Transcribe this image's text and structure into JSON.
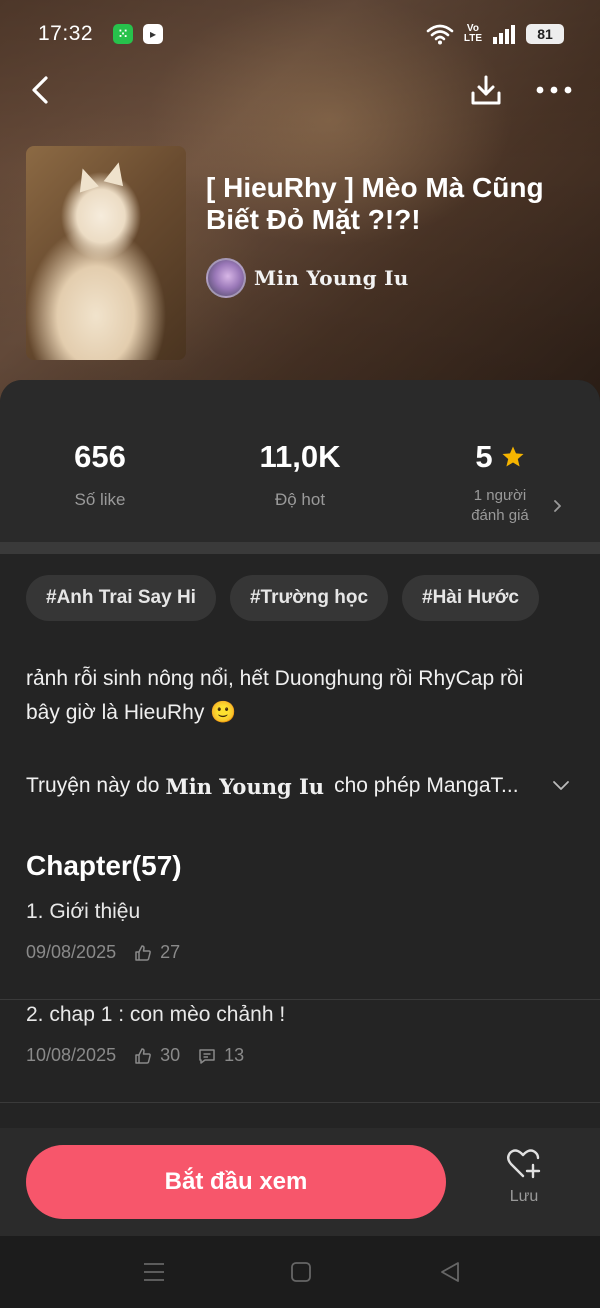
{
  "status_bar": {
    "time": "17:32",
    "lte_top": "Vo",
    "lte_bottom": "LTE",
    "battery": "81"
  },
  "comic": {
    "title": "[ HieuRhy ] Mèo Mà Cũng Biết Đỏ Mặt ?!?!",
    "author": "Min Young Iu"
  },
  "stats": [
    {
      "value": "656",
      "label": "Số like"
    },
    {
      "value": "11,0K",
      "label": "Độ hot"
    },
    {
      "value": "5",
      "label_line1": "1 người",
      "label_line2": "đánh giá"
    }
  ],
  "tags": [
    "#Anh Trai Say Hi",
    "#Trường học",
    "#Hài Hước"
  ],
  "description": "rảnh rỗi sinh nông nổi, hết Duonghung rồi RhyCap rồi bây giờ là HieuRhy 🙂",
  "credit": {
    "prefix": "Truyện này do",
    "name": "Min Young Iu",
    "suffix": "cho phép MangaT..."
  },
  "chapter_heading": "Chapter(57)",
  "chapters": [
    {
      "title": "1. Giới thiệu",
      "date": "09/08/2025",
      "likes": "27",
      "comments": ""
    },
    {
      "title": "2. chap 1 : con mèo chảnh !",
      "date": "10/08/2025",
      "likes": "30",
      "comments": "13"
    }
  ],
  "actions": {
    "start_label": "Bắt đầu xem",
    "save_label": "Lưu"
  },
  "colors": {
    "accent": "#f7566b",
    "star": "#f5b400",
    "background": "#242424"
  },
  "icons": {
    "back": "chevron-left-icon",
    "download": "download-icon",
    "more": "more-dots-icon",
    "save": "heart-plus-icon",
    "like": "thumbs-up-icon",
    "comment": "comment-icon"
  }
}
